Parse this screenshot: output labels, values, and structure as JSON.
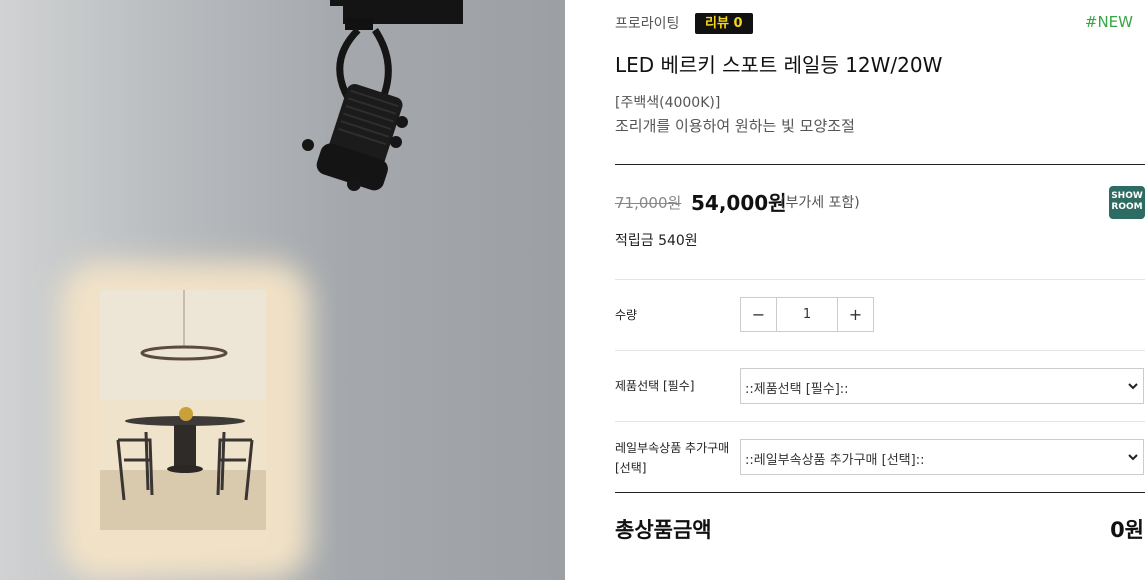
{
  "product_image": {
    "alt": "LED track spotlight photo"
  },
  "brand": {
    "name": "프로라이팅"
  },
  "review": {
    "label": "리뷰 0"
  },
  "new_tag": {
    "label": "#NEW"
  },
  "product": {
    "title": "LED 베르키 스포트 레일등 12W/20W",
    "desc_line1": "[주백색(4000K)]",
    "desc_line2": "조리개를 이용하여 원하는 빛 모양조절"
  },
  "price": {
    "original": "71,000원",
    "sale": "54,000원",
    "vat_note": "(부가세 포함)"
  },
  "showroom": {
    "line1": "SHOW",
    "line2": "ROOM",
    "color": "#2e6b62"
  },
  "points": {
    "label": "적립금 540원"
  },
  "quantity": {
    "label": "수량",
    "value": "1",
    "minus": "−",
    "plus": "+"
  },
  "product_select": {
    "label": "제품선택 [필수]",
    "selected": "::제품선택 [필수]::"
  },
  "rail_select": {
    "label_line1": "레일부속상품 추가구매",
    "label_line2": "[선택]",
    "selected": "::레일부속상품 추가구매 [선택]::"
  },
  "total": {
    "label": "총상품금액",
    "value": "0원"
  },
  "colors": {
    "accent_green": "#3aa547",
    "badge_bg": "#111111",
    "badge_text": "#f4d61c"
  }
}
